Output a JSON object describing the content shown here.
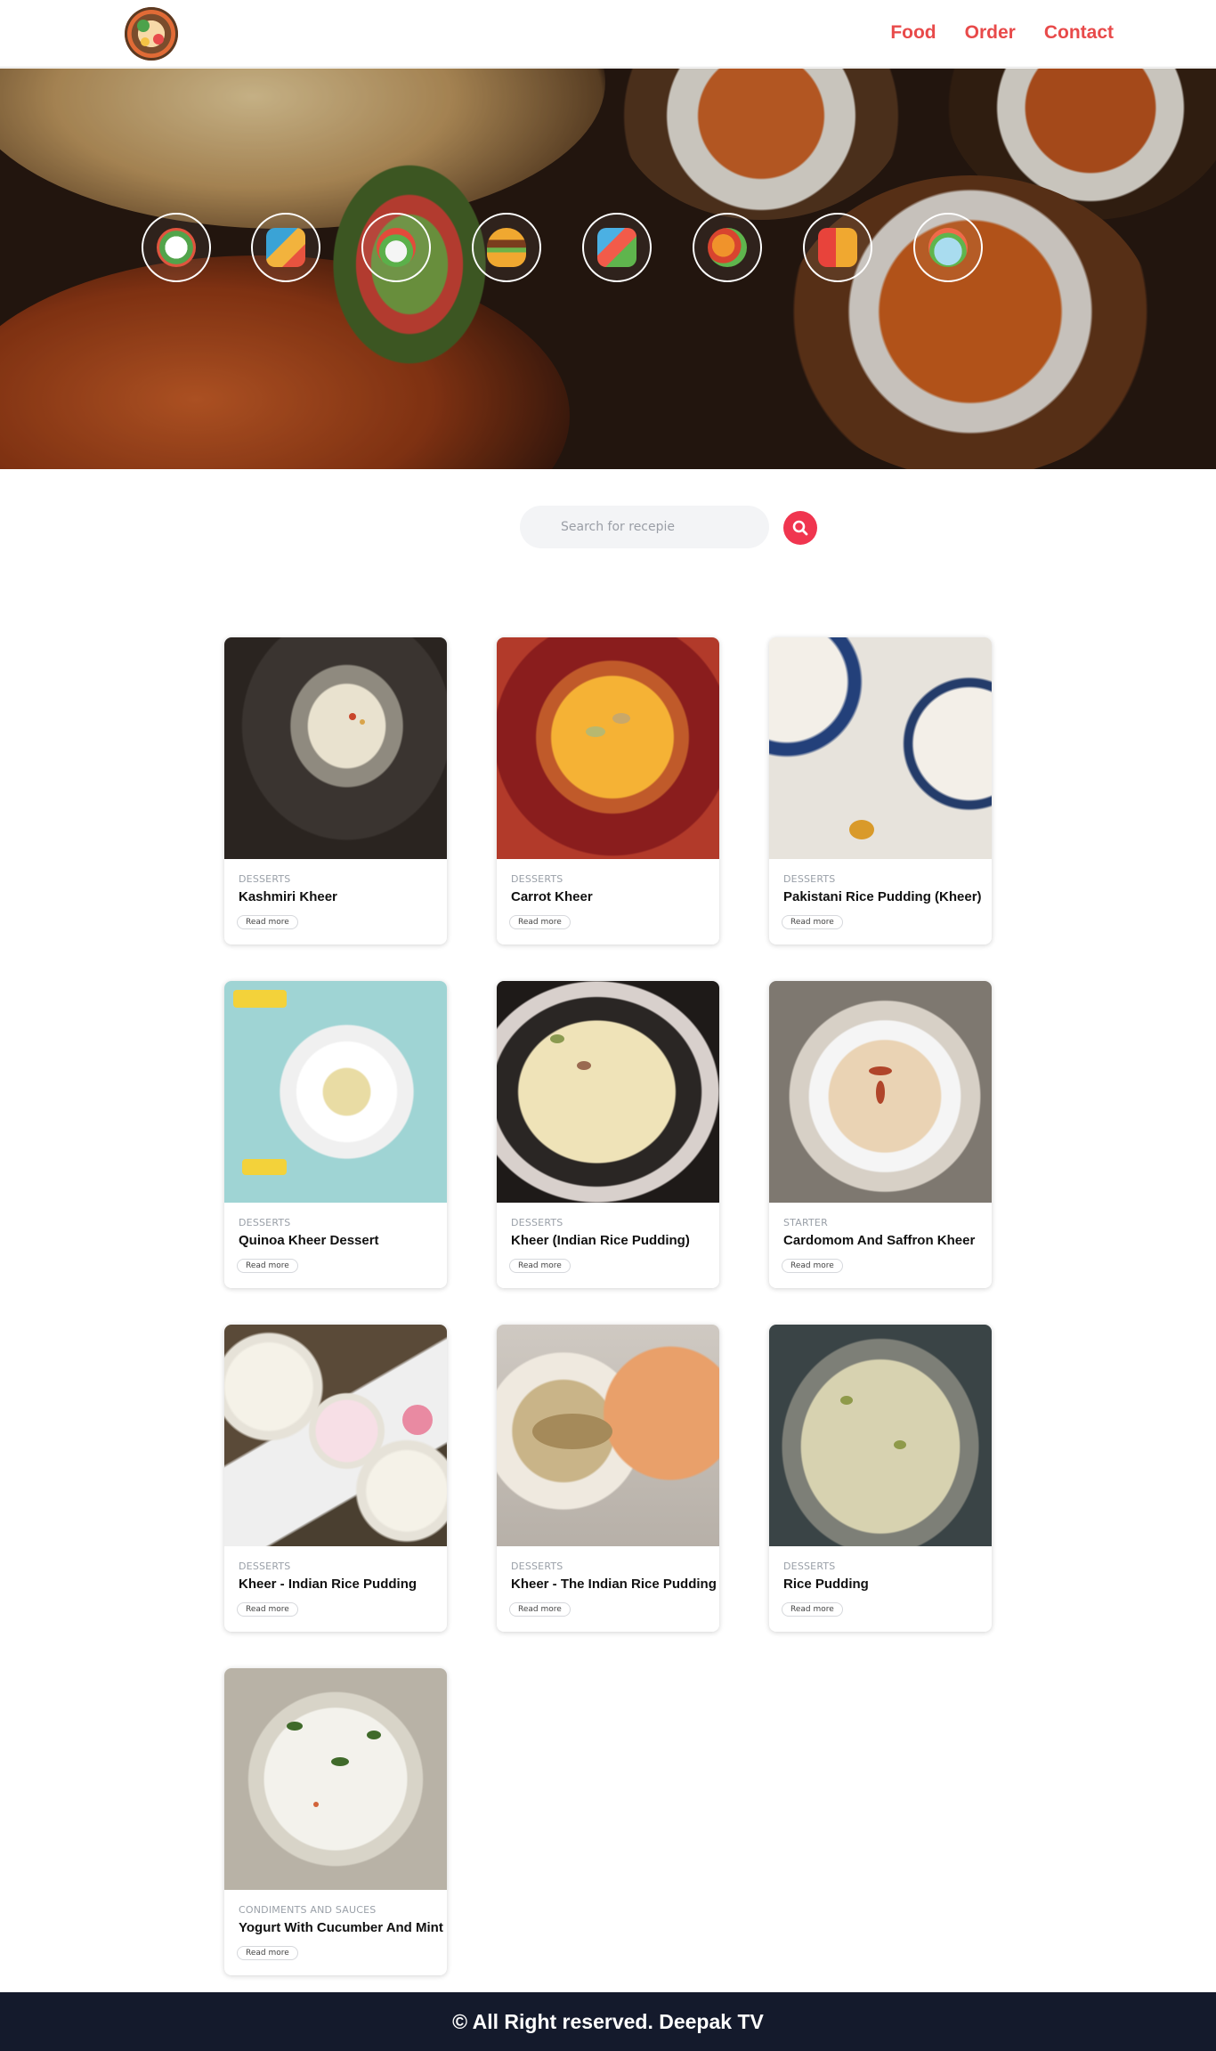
{
  "header": {
    "logo_icon": "food-bowl-logo",
    "nav": [
      {
        "label": "Food"
      },
      {
        "label": "Order"
      },
      {
        "label": "Contact"
      }
    ],
    "nav_color": "#e84a4a"
  },
  "hero": {
    "categories": [
      {
        "icon": "salad-plate-icon"
      },
      {
        "icon": "fast-food-drink-icon"
      },
      {
        "icon": "salad-bowl-icon"
      },
      {
        "icon": "burger-icon"
      },
      {
        "icon": "grocery-basket-icon"
      },
      {
        "icon": "fruits-vegetables-icon"
      },
      {
        "icon": "soda-burger-icon"
      },
      {
        "icon": "vegetable-bowl-icon"
      }
    ]
  },
  "search": {
    "placeholder": "Search for recepie",
    "value": "",
    "button_color": "#f0354f"
  },
  "cards": [
    {
      "category": "DESSERTS",
      "title": "Kashmiri Kheer",
      "button": "Read more"
    },
    {
      "category": "DESSERTS",
      "title": "Carrot Kheer",
      "button": "Read more"
    },
    {
      "category": "DESSERTS",
      "title": "Pakistani Rice Pudding (Kheer)",
      "button": "Read more"
    },
    {
      "category": "DESSERTS",
      "title": "Quinoa Kheer Dessert",
      "button": "Read more"
    },
    {
      "category": "DESSERTS",
      "title": "Kheer (Indian Rice Pudding)",
      "button": "Read more"
    },
    {
      "category": "STARTER",
      "title": "Cardomom And Saffron Kheer",
      "button": "Read more"
    },
    {
      "category": "DESSERTS",
      "title": "Kheer - Indian Rice Pudding",
      "button": "Read more"
    },
    {
      "category": "DESSERTS",
      "title": "Kheer - The Indian Rice Pudding",
      "button": "Read more"
    },
    {
      "category": "DESSERTS",
      "title": "Rice Pudding",
      "button": "Read more"
    },
    {
      "category": "CONDIMENTS AND SAUCES",
      "title": "Yogurt With Cucumber And Mint",
      "button": "Read more"
    }
  ],
  "footer": {
    "text": "© All Right reserved. Deepak TV",
    "background": "#141a2c"
  }
}
